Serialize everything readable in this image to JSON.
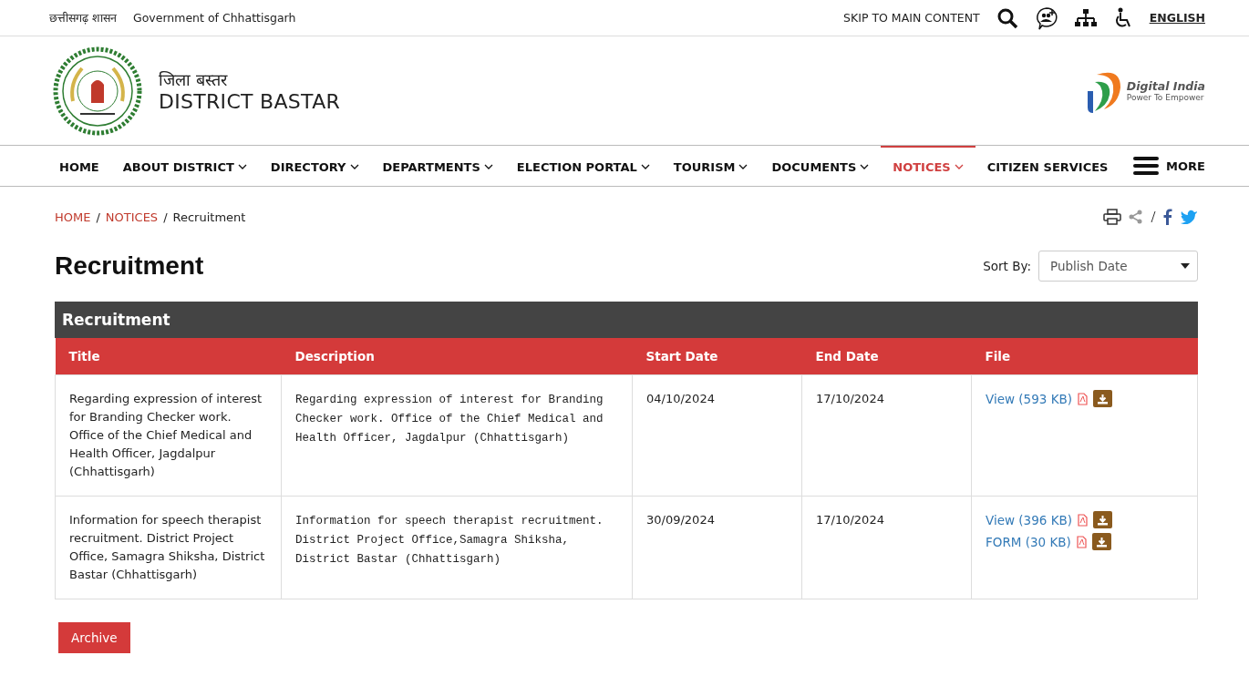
{
  "top_bar": {
    "state_name": "छत्तीसगढ़ शासन",
    "government": "Government of Chhattisgarh",
    "skip_link": "SKIP TO MAIN CONTENT",
    "language": "ENGLISH"
  },
  "header": {
    "title_hindi": "जिला बस्तर",
    "title": "DISTRICT BASTAR",
    "partner_logo": {
      "name": "Digital India",
      "tagline": "Power To Empower"
    }
  },
  "nav": {
    "items": [
      {
        "label": "HOME",
        "dropdown": false,
        "selected": false
      },
      {
        "label": "ABOUT DISTRICT",
        "dropdown": true,
        "selected": false
      },
      {
        "label": "DIRECTORY",
        "dropdown": true,
        "selected": false
      },
      {
        "label": "DEPARTMENTS",
        "dropdown": true,
        "selected": false
      },
      {
        "label": "ELECTION PORTAL",
        "dropdown": true,
        "selected": false
      },
      {
        "label": "TOURISM",
        "dropdown": true,
        "selected": false
      },
      {
        "label": "DOCUMENTS",
        "dropdown": true,
        "selected": false
      },
      {
        "label": "NOTICES",
        "dropdown": true,
        "selected": true
      },
      {
        "label": "CITIZEN SERVICES",
        "dropdown": false,
        "selected": false
      }
    ],
    "more": "MORE"
  },
  "breadcrumb": [
    {
      "kind": "link",
      "label": "HOME"
    },
    {
      "kind": "separator",
      "label": "/"
    },
    {
      "kind": "link",
      "label": "NOTICES"
    },
    {
      "kind": "separator",
      "label": "/"
    },
    {
      "kind": "current",
      "label": "Recruitment"
    }
  ],
  "page_title": "Recruitment",
  "sort": {
    "label": "Sort By:",
    "value": "Publish Date"
  },
  "table": {
    "caption": "Recruitment",
    "columns": [
      "Title",
      "Description",
      "Start Date",
      "End Date",
      "File"
    ],
    "rows": [
      {
        "title": "Regarding expression of interest for Branding Checker work. Office of the Chief Medical and Health Officer, Jagdalpur (Chhattisgarh)",
        "description": "Regarding expression of interest for Branding Checker work. Office of the Chief Medical and Health Officer, Jagdalpur (Chhattisgarh)",
        "start": "04/10/2024",
        "end": "17/10/2024",
        "files": [
          "View (593 KB)"
        ]
      },
      {
        "title": "Information for speech therapist recruitment. District Project Office, Samagra Shiksha, District Bastar (Chhattisgarh)",
        "description": "Information for speech therapist recruitment. District Project Office,Samagra Shiksha, District Bastar (Chhattisgarh)",
        "start": "30/09/2024",
        "end": "17/10/2024",
        "files": [
          "View (396 KB)",
          "FORM (30 KB)"
        ]
      }
    ]
  },
  "archive_button": "Archive"
}
